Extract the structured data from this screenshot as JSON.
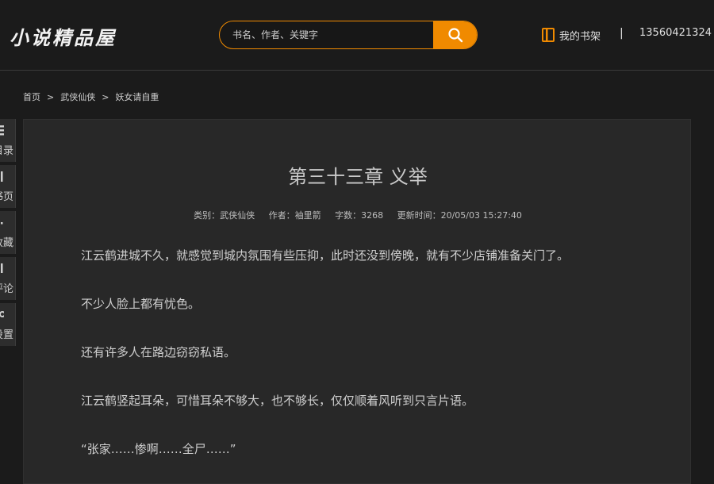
{
  "site": {
    "logo": "小说精品屋"
  },
  "search": {
    "placeholder": "书名、作者、关键字"
  },
  "header": {
    "shelf_label": "我的书架",
    "separator": "|",
    "user": "13560421324"
  },
  "breadcrumb": [
    {
      "label": "首页"
    },
    {
      "label": "武侠仙侠"
    },
    {
      "label": "妖女请自重"
    }
  ],
  "breadcrumb_sep": ">",
  "sidebar": {
    "items": [
      {
        "icon": "list-icon",
        "label": "目录"
      },
      {
        "icon": "book-icon",
        "label": "书页"
      },
      {
        "icon": "bookmark-icon",
        "label": "收藏"
      },
      {
        "icon": "comment-icon",
        "label": "评论"
      },
      {
        "icon": "settings-icon",
        "label": "设置"
      }
    ]
  },
  "chapter": {
    "title": "第三十三章 义举",
    "meta": {
      "category": "类别：武侠仙侠",
      "author": "作者：袖里箭",
      "words": "字数：3268",
      "updated": "更新时间：20/05/03 15:27:40"
    },
    "paragraphs": [
      "江云鹤进城不久，就感觉到城内氛围有些压抑，此时还没到傍晚，就有不少店铺准备关门了。",
      "不少人脸上都有忧色。",
      "还有许多人在路边窃窃私语。",
      "江云鹤竖起耳朵，可惜耳朵不够大，也不够长，仅仅顺着风听到只言片语。",
      "“张家……惨啊……全尸……”"
    ]
  },
  "colors": {
    "accent": "#f08a00",
    "background": "#1b1b1b",
    "panel": "#282828"
  }
}
